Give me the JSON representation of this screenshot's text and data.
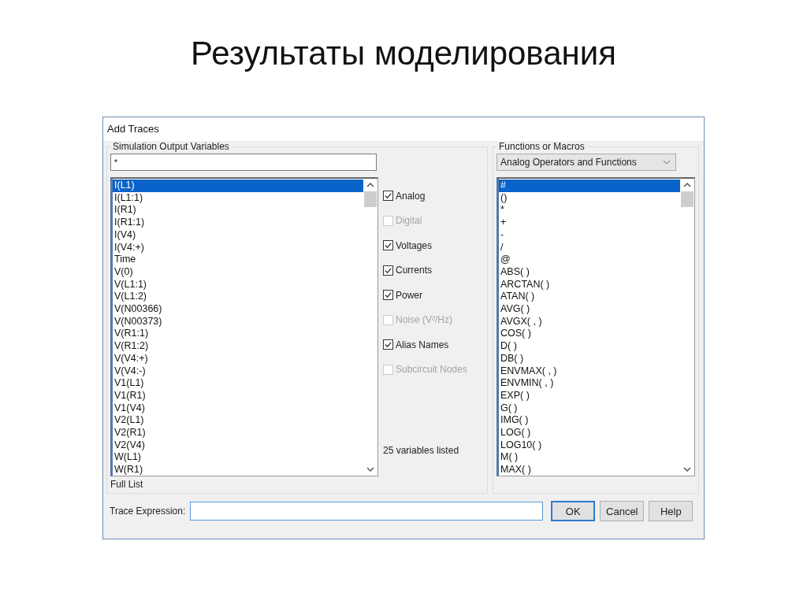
{
  "slide_title": "Результаты моделирования",
  "window": {
    "title": "Add Traces"
  },
  "variables": {
    "group_label": "Simulation Output Variables",
    "filter": "*",
    "items": [
      {
        "label": "I(L1)",
        "selected": true
      },
      {
        "label": "I(L1:1)",
        "selected": false
      },
      {
        "label": "I(R1)",
        "selected": false
      },
      {
        "label": "I(R1:1)",
        "selected": false
      },
      {
        "label": "I(V4)",
        "selected": false
      },
      {
        "label": "I(V4:+)",
        "selected": false
      },
      {
        "label": "Time",
        "selected": false
      },
      {
        "label": "V(0)",
        "selected": false
      },
      {
        "label": "V(L1:1)",
        "selected": false
      },
      {
        "label": "V(L1:2)",
        "selected": false
      },
      {
        "label": "V(N00366)",
        "selected": false
      },
      {
        "label": "V(N00373)",
        "selected": false
      },
      {
        "label": "V(R1:1)",
        "selected": false
      },
      {
        "label": "V(R1:2)",
        "selected": false
      },
      {
        "label": "V(V4:+)",
        "selected": false
      },
      {
        "label": "V(V4:-)",
        "selected": false
      },
      {
        "label": "V1(L1)",
        "selected": false
      },
      {
        "label": "V1(R1)",
        "selected": false
      },
      {
        "label": "V1(V4)",
        "selected": false
      },
      {
        "label": "V2(L1)",
        "selected": false
      },
      {
        "label": "V2(R1)",
        "selected": false
      },
      {
        "label": "V2(V4)",
        "selected": false
      },
      {
        "label": "W(L1)",
        "selected": false
      },
      {
        "label": "W(R1)",
        "selected": false
      }
    ],
    "footer": "Full List"
  },
  "filters": [
    {
      "label": "Analog",
      "checked": true,
      "disabled": false
    },
    {
      "label": "Digital",
      "checked": false,
      "disabled": true
    },
    {
      "label": "Voltages",
      "checked": true,
      "disabled": false
    },
    {
      "label": "Currents",
      "checked": true,
      "disabled": false
    },
    {
      "label": "Power",
      "checked": true,
      "disabled": false
    },
    {
      "label": "Noise (V²/Hz)",
      "checked": false,
      "disabled": true
    },
    {
      "label": "Alias Names",
      "checked": true,
      "disabled": false
    },
    {
      "label": "Subcircuit Nodes",
      "checked": false,
      "disabled": true
    }
  ],
  "count": "25 variables listed",
  "functions": {
    "group_label": "Functions or Macros",
    "dropdown": "Analog Operators and Functions",
    "items": [
      {
        "label": "#",
        "selected": true
      },
      {
        "label": "()",
        "selected": false
      },
      {
        "label": "*",
        "selected": false
      },
      {
        "label": "+",
        "selected": false
      },
      {
        "label": "-",
        "selected": false
      },
      {
        "label": "/",
        "selected": false
      },
      {
        "label": "@",
        "selected": false
      },
      {
        "label": "ABS( )",
        "selected": false
      },
      {
        "label": "ARCTAN( )",
        "selected": false
      },
      {
        "label": "ATAN( )",
        "selected": false
      },
      {
        "label": "AVG( )",
        "selected": false
      },
      {
        "label": "AVGX( , )",
        "selected": false
      },
      {
        "label": "COS( )",
        "selected": false
      },
      {
        "label": "D( )",
        "selected": false
      },
      {
        "label": "DB( )",
        "selected": false
      },
      {
        "label": "ENVMAX( , )",
        "selected": false
      },
      {
        "label": "ENVMIN( , )",
        "selected": false
      },
      {
        "label": "EXP( )",
        "selected": false
      },
      {
        "label": "G( )",
        "selected": false
      },
      {
        "label": "IMG( )",
        "selected": false
      },
      {
        "label": "LOG( )",
        "selected": false
      },
      {
        "label": "LOG10( )",
        "selected": false
      },
      {
        "label": "M( )",
        "selected": false
      },
      {
        "label": "MAX( )",
        "selected": false
      }
    ]
  },
  "trace_expression": {
    "label": "Trace Expression:"
  },
  "buttons": [
    "OK",
    "Cancel",
    "Help"
  ]
}
